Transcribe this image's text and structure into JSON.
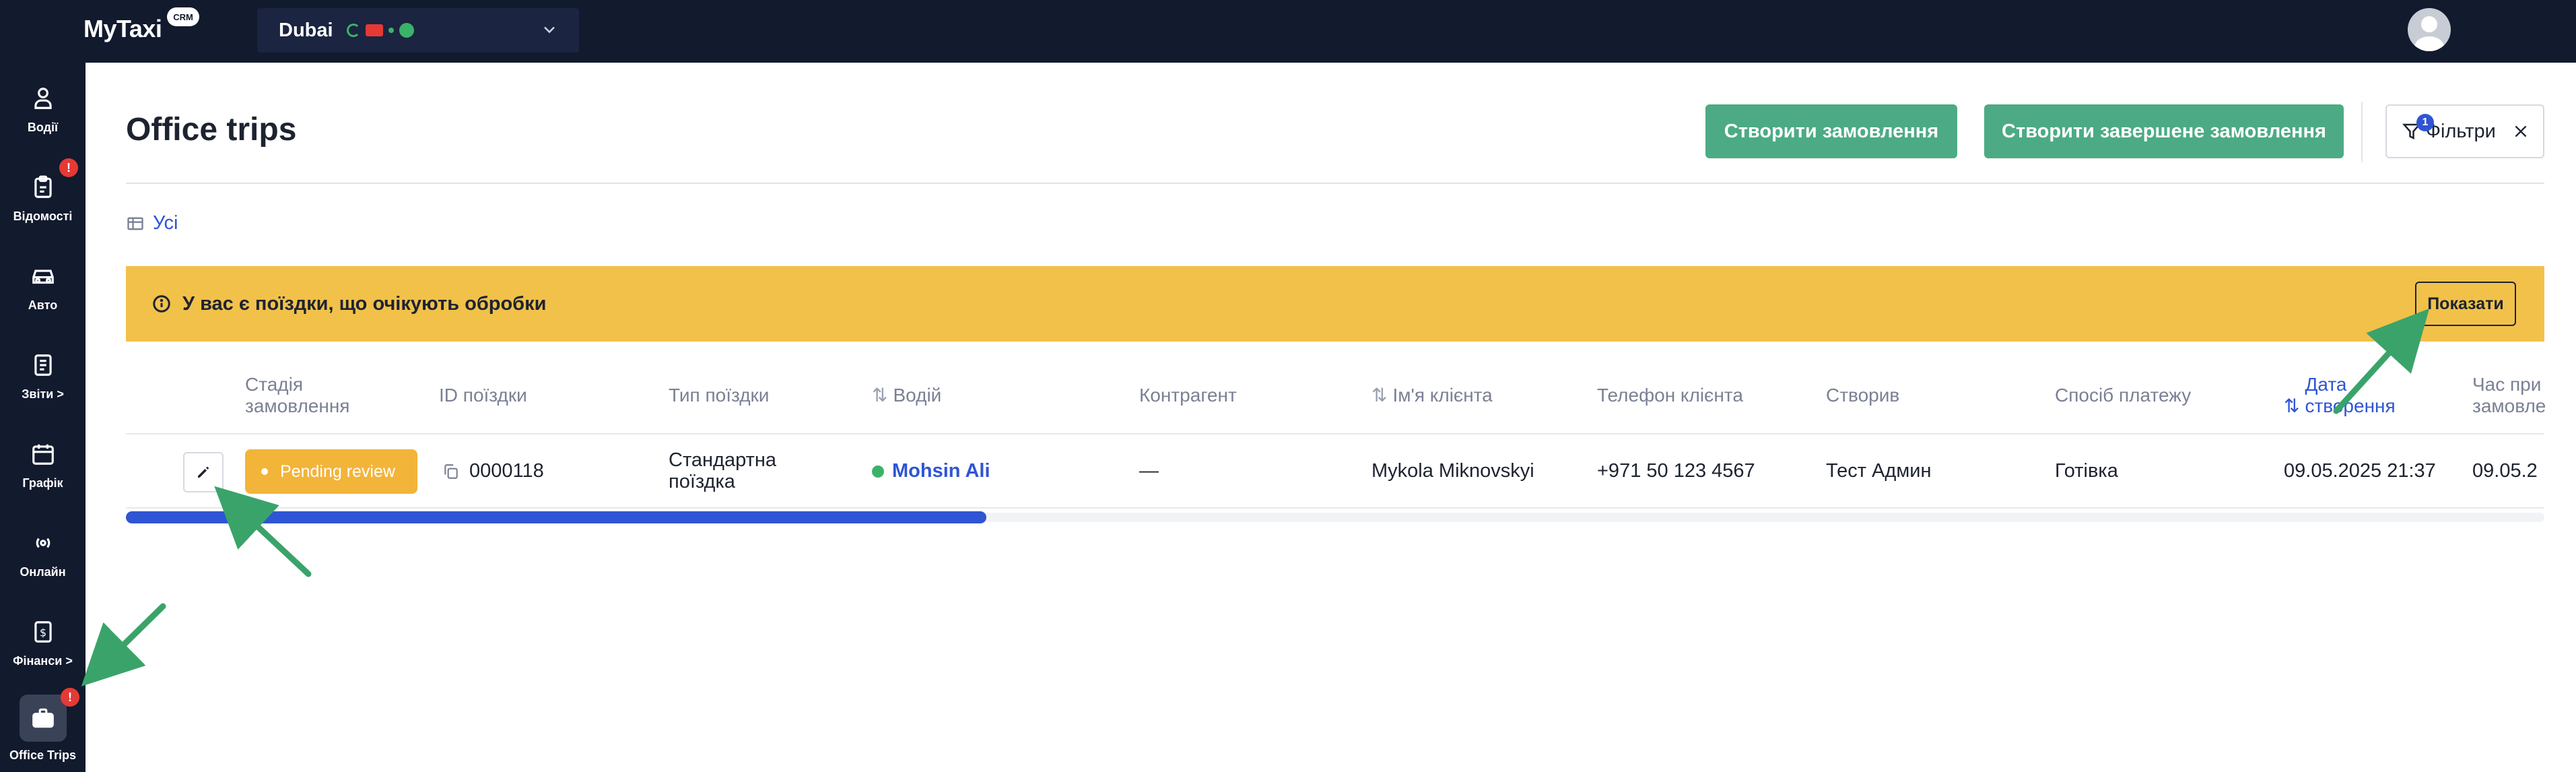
{
  "app": {
    "brand": "MyTaxi",
    "badge": "CRM"
  },
  "city": {
    "name": "Dubai"
  },
  "sidebar": {
    "items": [
      {
        "label": "Водії",
        "icon": "person-icon"
      },
      {
        "label": "Відомості",
        "icon": "clipboard-icon",
        "badge": "!"
      },
      {
        "label": "Авто",
        "icon": "car-icon"
      },
      {
        "label": "Звіти >",
        "icon": "report-icon"
      },
      {
        "label": "Графік",
        "icon": "calendar-icon"
      },
      {
        "label": "Онлайн",
        "icon": "broadcast-icon"
      },
      {
        "label": "Фінанси >",
        "icon": "finance-icon"
      },
      {
        "label": "Office Trips",
        "icon": "briefcase-icon",
        "badge": "!"
      }
    ]
  },
  "page": {
    "title": "Office trips",
    "create_order": "Створити замовлення",
    "create_completed_order": "Створити завершене замовлення",
    "filters": "Фільтри",
    "filter_count": "1",
    "view_tab": "Усі"
  },
  "banner": {
    "text": "У вас є поїздки, що очікують обробки",
    "show_button": "Показати"
  },
  "table": {
    "headers": {
      "stage": "Стадія\nзамовлення",
      "trip_id": "ID поїздки",
      "trip_type": "Тип поїздки",
      "driver": "Водій",
      "counterparty": "Контрагент",
      "client_name": "Ім'я клієнта",
      "client_phone": "Телефон клієнта",
      "created_by": "Створив",
      "payment": "Спосіб платежу",
      "created_date": "Дата\nстворення",
      "order_time": "Час при\nзамовле"
    },
    "row": {
      "stage": "Pending review",
      "trip_id": "0000118",
      "trip_type": "Стандартна\nпоїздка",
      "driver": "Mohsin Ali",
      "counterparty": "—",
      "client_name": "Mykola Miknovskyi",
      "client_phone": "+971 50 123 4567",
      "created_by": "Тест Админ",
      "payment": "Готівка",
      "created_date": "09.05.2025 21:37",
      "order_time": "09.05.2"
    }
  },
  "colors": {
    "nav_bg": "#121a2e",
    "accent_green": "#4cab84",
    "banner_yellow": "#f1c14a",
    "pending_orange": "#f3b43a",
    "link_blue": "#2f55d4",
    "arrow_green": "#3aa36a"
  }
}
